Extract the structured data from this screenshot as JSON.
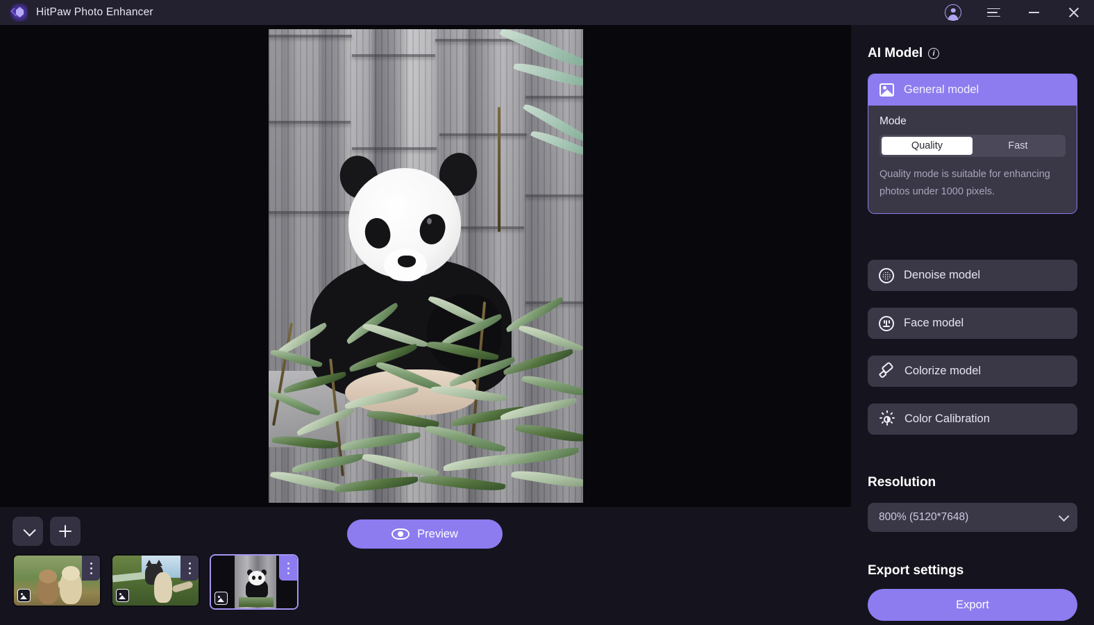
{
  "titlebar": {
    "app_title": "HitPaw Photo Enhancer",
    "logo_icon": "hitpaw-logo-icon",
    "account_icon": "account-circle-icon",
    "menu_icon": "hamburger-menu-icon",
    "minimize_icon": "minimize-icon",
    "close_icon": "close-icon",
    "background": "#232030"
  },
  "canvas": {
    "image_alt": "Giant panda eating bamboo in front of grey bamboo stalks",
    "background": "#08070c"
  },
  "bottombar": {
    "collapse_icon": "chevron-down-icon",
    "add_icon": "plus-icon",
    "preview": {
      "label": "Preview",
      "icon": "eye-icon",
      "accent": "#8c7cf0"
    },
    "thumbnails": [
      {
        "name": "puppies-thumbnail",
        "alt": "Two puppies on grass",
        "selected": false,
        "menu_icon": "kebab-menu-icon",
        "badge_icon": "picture-icon"
      },
      {
        "name": "cats-thumbnail",
        "alt": "Two cats in a garden",
        "selected": false,
        "menu_icon": "kebab-menu-icon",
        "badge_icon": "picture-icon"
      },
      {
        "name": "panda-thumbnail",
        "alt": "Panda among bamboo",
        "selected": true,
        "menu_icon": "kebab-menu-icon",
        "badge_icon": "picture-icon"
      }
    ]
  },
  "panel": {
    "ai_model": {
      "title": "AI Model",
      "info_icon": "info-icon",
      "info_glyph": "i",
      "accent": "#8c7cf0"
    },
    "selected_model": {
      "label": "General model",
      "icon": "picture-icon",
      "mode": {
        "label": "Mode",
        "options": [
          "Quality",
          "Fast"
        ],
        "selected": "Quality",
        "description": "Quality mode is suitable for enhancing photos under 1000 pixels."
      }
    },
    "models": [
      {
        "label": "Denoise model",
        "icon": "denoise-icon"
      },
      {
        "label": "Face model",
        "icon": "face-icon"
      },
      {
        "label": "Colorize model",
        "icon": "paint-roller-icon"
      },
      {
        "label": "Color Calibration",
        "icon": "brightness-sun-icon"
      }
    ],
    "resolution": {
      "title": "Resolution",
      "value": "800% (5120*7648)",
      "chevron_icon": "chevron-down-icon"
    },
    "export": {
      "title": "Export settings",
      "button_label": "Export"
    }
  }
}
